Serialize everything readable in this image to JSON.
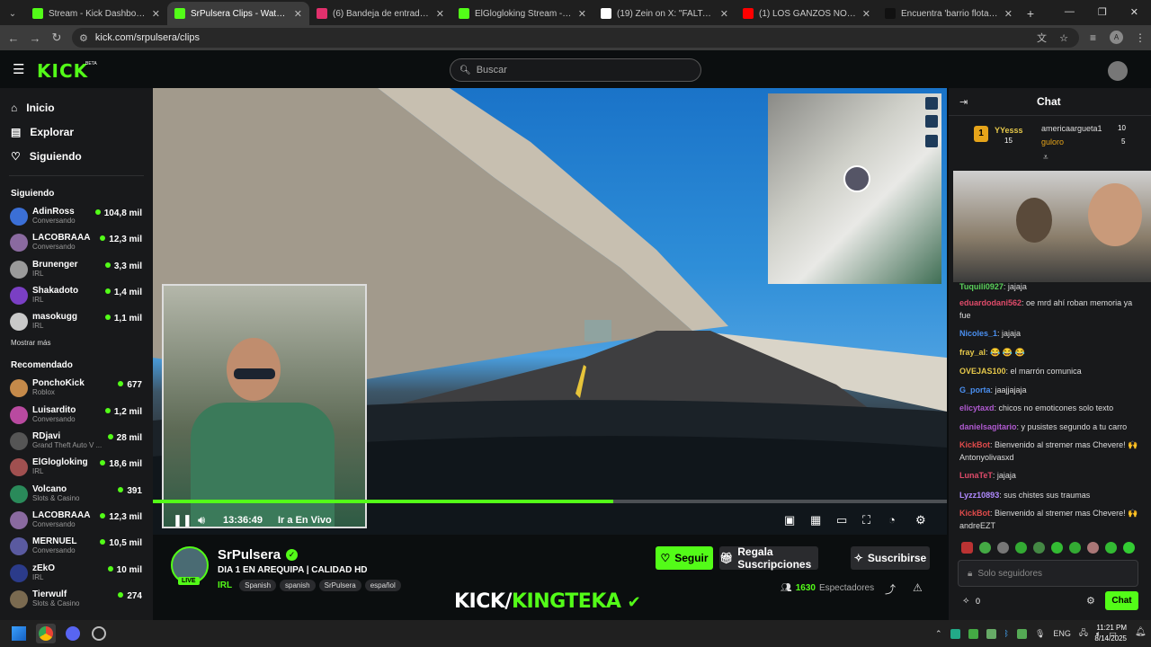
{
  "browser": {
    "tabs": [
      {
        "title": "Stream - Kick Dashboard",
        "color": "#53fc18",
        "active": false
      },
      {
        "title": "SrPulsera Clips - Watch Live",
        "color": "#53fc18",
        "active": true
      },
      {
        "title": "(6) Bandeja de entrada • Chats",
        "color": "#e1306c",
        "active": false
      },
      {
        "title": "ElGlogloking Stream - Watch Li",
        "color": "#53fc18",
        "active": false
      },
      {
        "title": "(19) Zein on X: \"FALTAN SOLO 2",
        "color": "#ffffff",
        "active": false
      },
      {
        "title": "(1) LOS GANZOS NO VAN AL C",
        "color": "#ff0000",
        "active": false
      },
      {
        "title": "Encuentra 'barrio flotante iquit",
        "color": "#111111",
        "active": false
      }
    ],
    "url": "kick.com/srpulsera/clips"
  },
  "header": {
    "logo": "KICK",
    "beta": "BETA",
    "search_placeholder": "Buscar"
  },
  "sidebar": {
    "nav": [
      {
        "label": "Inicio",
        "icon": "home-icon"
      },
      {
        "label": "Explorar",
        "icon": "browse-icon"
      },
      {
        "label": "Siguiendo",
        "icon": "heart-icon"
      }
    ],
    "following_title": "Siguiendo",
    "following": [
      {
        "name": "AdinRoss",
        "category": "Conversando",
        "viewers": "104,8 mil",
        "color": "#3b6fd6"
      },
      {
        "name": "LACOBRAAA",
        "category": "Conversando",
        "viewers": "12,3 mil",
        "color": "#8a6aa0"
      },
      {
        "name": "Brunenger",
        "category": "IRL",
        "viewers": "3,3 mil",
        "color": "#9a9a9a"
      },
      {
        "name": "Shakadoto",
        "category": "IRL",
        "viewers": "1,4 mil",
        "color": "#7a3fc4"
      },
      {
        "name": "masokugg",
        "category": "IRL",
        "viewers": "1,1 mil",
        "color": "#c9c9c9"
      }
    ],
    "show_more": "Mostrar más",
    "recommended_title": "Recomendado",
    "recommended": [
      {
        "name": "PonchoKick",
        "category": "Roblox",
        "viewers": "677",
        "color": "#c58a4a"
      },
      {
        "name": "Luisardito",
        "category": "Conversando",
        "viewers": "1,2 mil",
        "color": "#b94aa0"
      },
      {
        "name": "RDjavi",
        "category": "Grand Theft Auto V ...",
        "viewers": "28 mil",
        "color": "#555555"
      },
      {
        "name": "ElGlogloking",
        "category": "IRL",
        "viewers": "18,6 mil",
        "color": "#a05050"
      },
      {
        "name": "Volcano",
        "category": "Slots & Casino",
        "viewers": "391",
        "color": "#2a8a5a"
      },
      {
        "name": "LACOBRAAA",
        "category": "Conversando",
        "viewers": "12,3 mil",
        "color": "#8a6aa0"
      },
      {
        "name": "MERNUEL",
        "category": "Conversando",
        "viewers": "10,5 mil",
        "color": "#5a5aa0"
      },
      {
        "name": "zEkO",
        "category": "IRL",
        "viewers": "10 mil",
        "color": "#2b3b8a"
      },
      {
        "name": "Tierwulf",
        "category": "Slots & Casino",
        "viewers": "274",
        "color": "#7a6a50"
      }
    ]
  },
  "player": {
    "time": "13:36:49",
    "go_live": "Ir a En Vivo",
    "progress": 0.58
  },
  "channel": {
    "name": "SrPulsera",
    "live": "LIVE",
    "title": "DIA 1 EN AREQUIPA | CALIDAD HD",
    "category": "IRL",
    "tags": [
      "Spanish",
      "spanish",
      "SrPulsera",
      "español"
    ],
    "follow": "Seguir",
    "gift": "Regala Suscripciones",
    "subscribe": "Suscribirse",
    "viewers": "1630",
    "viewers_label": "Espectadores",
    "watermark_a": "KICK/",
    "watermark_b": "KINGTEKA"
  },
  "chat": {
    "title": "Chat",
    "leaderboard": [
      {
        "rank": "1",
        "name": "YYesss",
        "count": "15"
      },
      {
        "name": "americaargueta1",
        "count": "10"
      },
      {
        "name": "guloro",
        "count": "5"
      }
    ],
    "messages": [
      {
        "user": "Tuquili0927",
        "color": "#5ad15a",
        "text": "jajaja"
      },
      {
        "user": "eduardodani562",
        "color": "#e04b6a",
        "text": "oe mrd ahí roban memoria ya fue"
      },
      {
        "user": "Nicoles_1",
        "color": "#4a8ff0",
        "text": "jajaja"
      },
      {
        "user": "fray_al",
        "color": "#e6c84a",
        "text": "😂 😂 😂"
      },
      {
        "user": "OVEJAS100",
        "color": "#e6c84a",
        "text": "el marrón comunica"
      },
      {
        "user": "G_porta",
        "color": "#4a8ff0",
        "text": "jaajjajaja"
      },
      {
        "user": "elicytaxd",
        "color": "#b05ad1",
        "text": "chicos no emoticones solo texto"
      },
      {
        "user": "danielsagitario",
        "color": "#b05ad1",
        "text": "y pusistes segundo a tu carro"
      },
      {
        "user": "KickBot",
        "color": "#e04b4b",
        "text": "Bienvenido al stremer mas Chevere! 🙌 Antonyolivasxd"
      },
      {
        "user": "LunaTeT",
        "color": "#e04b6a",
        "text": "jajaja"
      },
      {
        "user": "Lyzz10893",
        "color": "#b08aff",
        "text": "sus chistes sus traumas"
      },
      {
        "user": "KickBot",
        "color": "#e04b4b",
        "text": "Bienvenido al stremer mas Chevere! 🙌 andreEZT"
      }
    ],
    "input_placeholder": "Solo seguidores",
    "points": "0",
    "send": "Chat"
  },
  "taskbar": {
    "lang": "ENG",
    "time": "11:21 PM",
    "date": "8/14/2025"
  }
}
